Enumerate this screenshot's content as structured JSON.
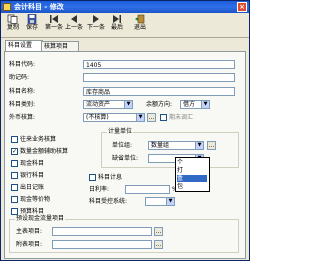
{
  "window": {
    "title": "会计科目 - 修改",
    "close_glyph": "×"
  },
  "toolbar": [
    {
      "name": "copy-button",
      "icon": "copy-icon",
      "label": "复制"
    },
    {
      "name": "save-button",
      "icon": "save-icon",
      "label": "保存"
    },
    {
      "name": "first-button",
      "icon": "first-icon",
      "label": "第一条"
    },
    {
      "name": "prev-button",
      "icon": "prev-icon",
      "label": "上一条"
    },
    {
      "name": "next-button",
      "icon": "next-icon",
      "label": "下一条"
    },
    {
      "name": "last-button",
      "icon": "last-icon",
      "label": "最后"
    },
    {
      "name": "exit-button",
      "icon": "exit-icon",
      "label": "退出"
    }
  ],
  "tabs": [
    "科目设置",
    "核算项目"
  ],
  "form": {
    "code_label": "科目代码:",
    "code_value": "1405",
    "helper_label": "助记码:",
    "helper_value": "",
    "name_label": "科目名称:",
    "name_value": "库存商品",
    "category_label": "科目类别:",
    "category_value": "流动资产",
    "balance_label": "余额方向:",
    "balance_value": "借方",
    "fx_label": "外币核算:",
    "fx_value": "(不核算)",
    "period_check_label": "期末调汇"
  },
  "checks": [
    {
      "label": "往来业务核算",
      "checked": false
    },
    {
      "label": "数量金额辅助核算",
      "checked": true
    },
    {
      "label": "现金科目",
      "checked": false
    },
    {
      "label": "银行科目",
      "checked": false
    },
    {
      "label": "出日记账",
      "checked": false
    },
    {
      "label": "现金等价物",
      "checked": false
    },
    {
      "label": "预算科目",
      "checked": false
    }
  ],
  "unit_group": {
    "title": "计量单位",
    "unit_group_label": "单位组:",
    "unit_group_value": "数量组",
    "default_unit_label": "缺省单位:",
    "default_unit_value": ""
  },
  "dropdown": {
    "items": [
      "个",
      "打",
      "盒",
      "包"
    ],
    "highlight_index": 2
  },
  "extra": {
    "item_count_label": "科目计息",
    "daily_rate_label": "日利率:",
    "rate_unit": "%",
    "category_sys_label": "科目受控系统:"
  },
  "cash_group": {
    "title": "预设现金流量项目",
    "main_label": "主表项目:",
    "sub_label": "附表项目:",
    "lookup_glyph": "…"
  }
}
